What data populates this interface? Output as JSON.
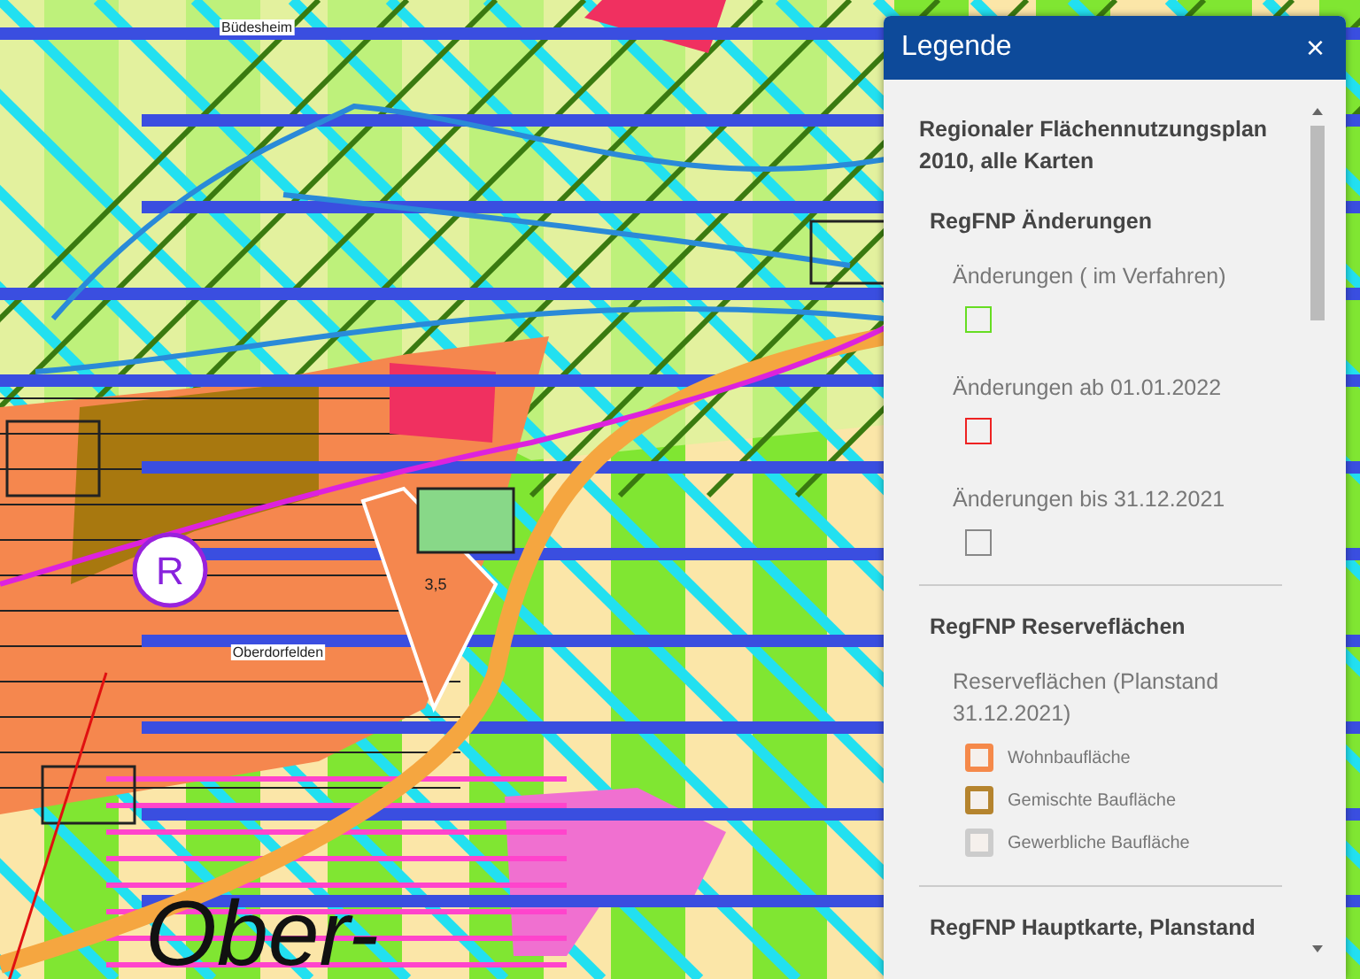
{
  "map": {
    "labels": [
      {
        "kind": "place",
        "text": "Büdesheim"
      },
      {
        "kind": "symbol",
        "text": "R"
      },
      {
        "kind": "number",
        "text": "3,5"
      },
      {
        "kind": "place",
        "text": "Oberdorfelden"
      },
      {
        "kind": "town",
        "text": "Ober-"
      }
    ]
  },
  "legend": {
    "title": "Legende",
    "close": "×",
    "heading": "Regionaler Flächennutzungsplan 2010, alle Karten",
    "sections": [
      {
        "title": "RegFNP Änderungen",
        "groups": [
          {
            "label": "Änderungen ( im Verfahren)",
            "items": [
              {
                "kind": "outline",
                "color": "#66dd22"
              }
            ]
          },
          {
            "label": "Änderungen ab 01.01.2022",
            "items": [
              {
                "kind": "outline",
                "color": "#ee2222"
              }
            ]
          },
          {
            "label": "Änderungen bis 31.12.2021",
            "items": [
              {
                "kind": "outline",
                "color": "#888888"
              }
            ]
          }
        ]
      },
      {
        "title": "RegFNP Reserveflächen",
        "groups": [
          {
            "label": "Reserveflächen (Planstand 31.12.2021)",
            "items": [
              {
                "kind": "framed",
                "color": "#f5894a",
                "label": "Wohnbaufläche"
              },
              {
                "kind": "framed",
                "color": "#b5842e",
                "label": "Gemischte Baufläche"
              },
              {
                "kind": "framed",
                "color": "#cccccc",
                "label": "Gewerbliche Baufläche"
              }
            ]
          }
        ]
      },
      {
        "title": "RegFNP Hauptkarte, Planstand"
      }
    ]
  }
}
